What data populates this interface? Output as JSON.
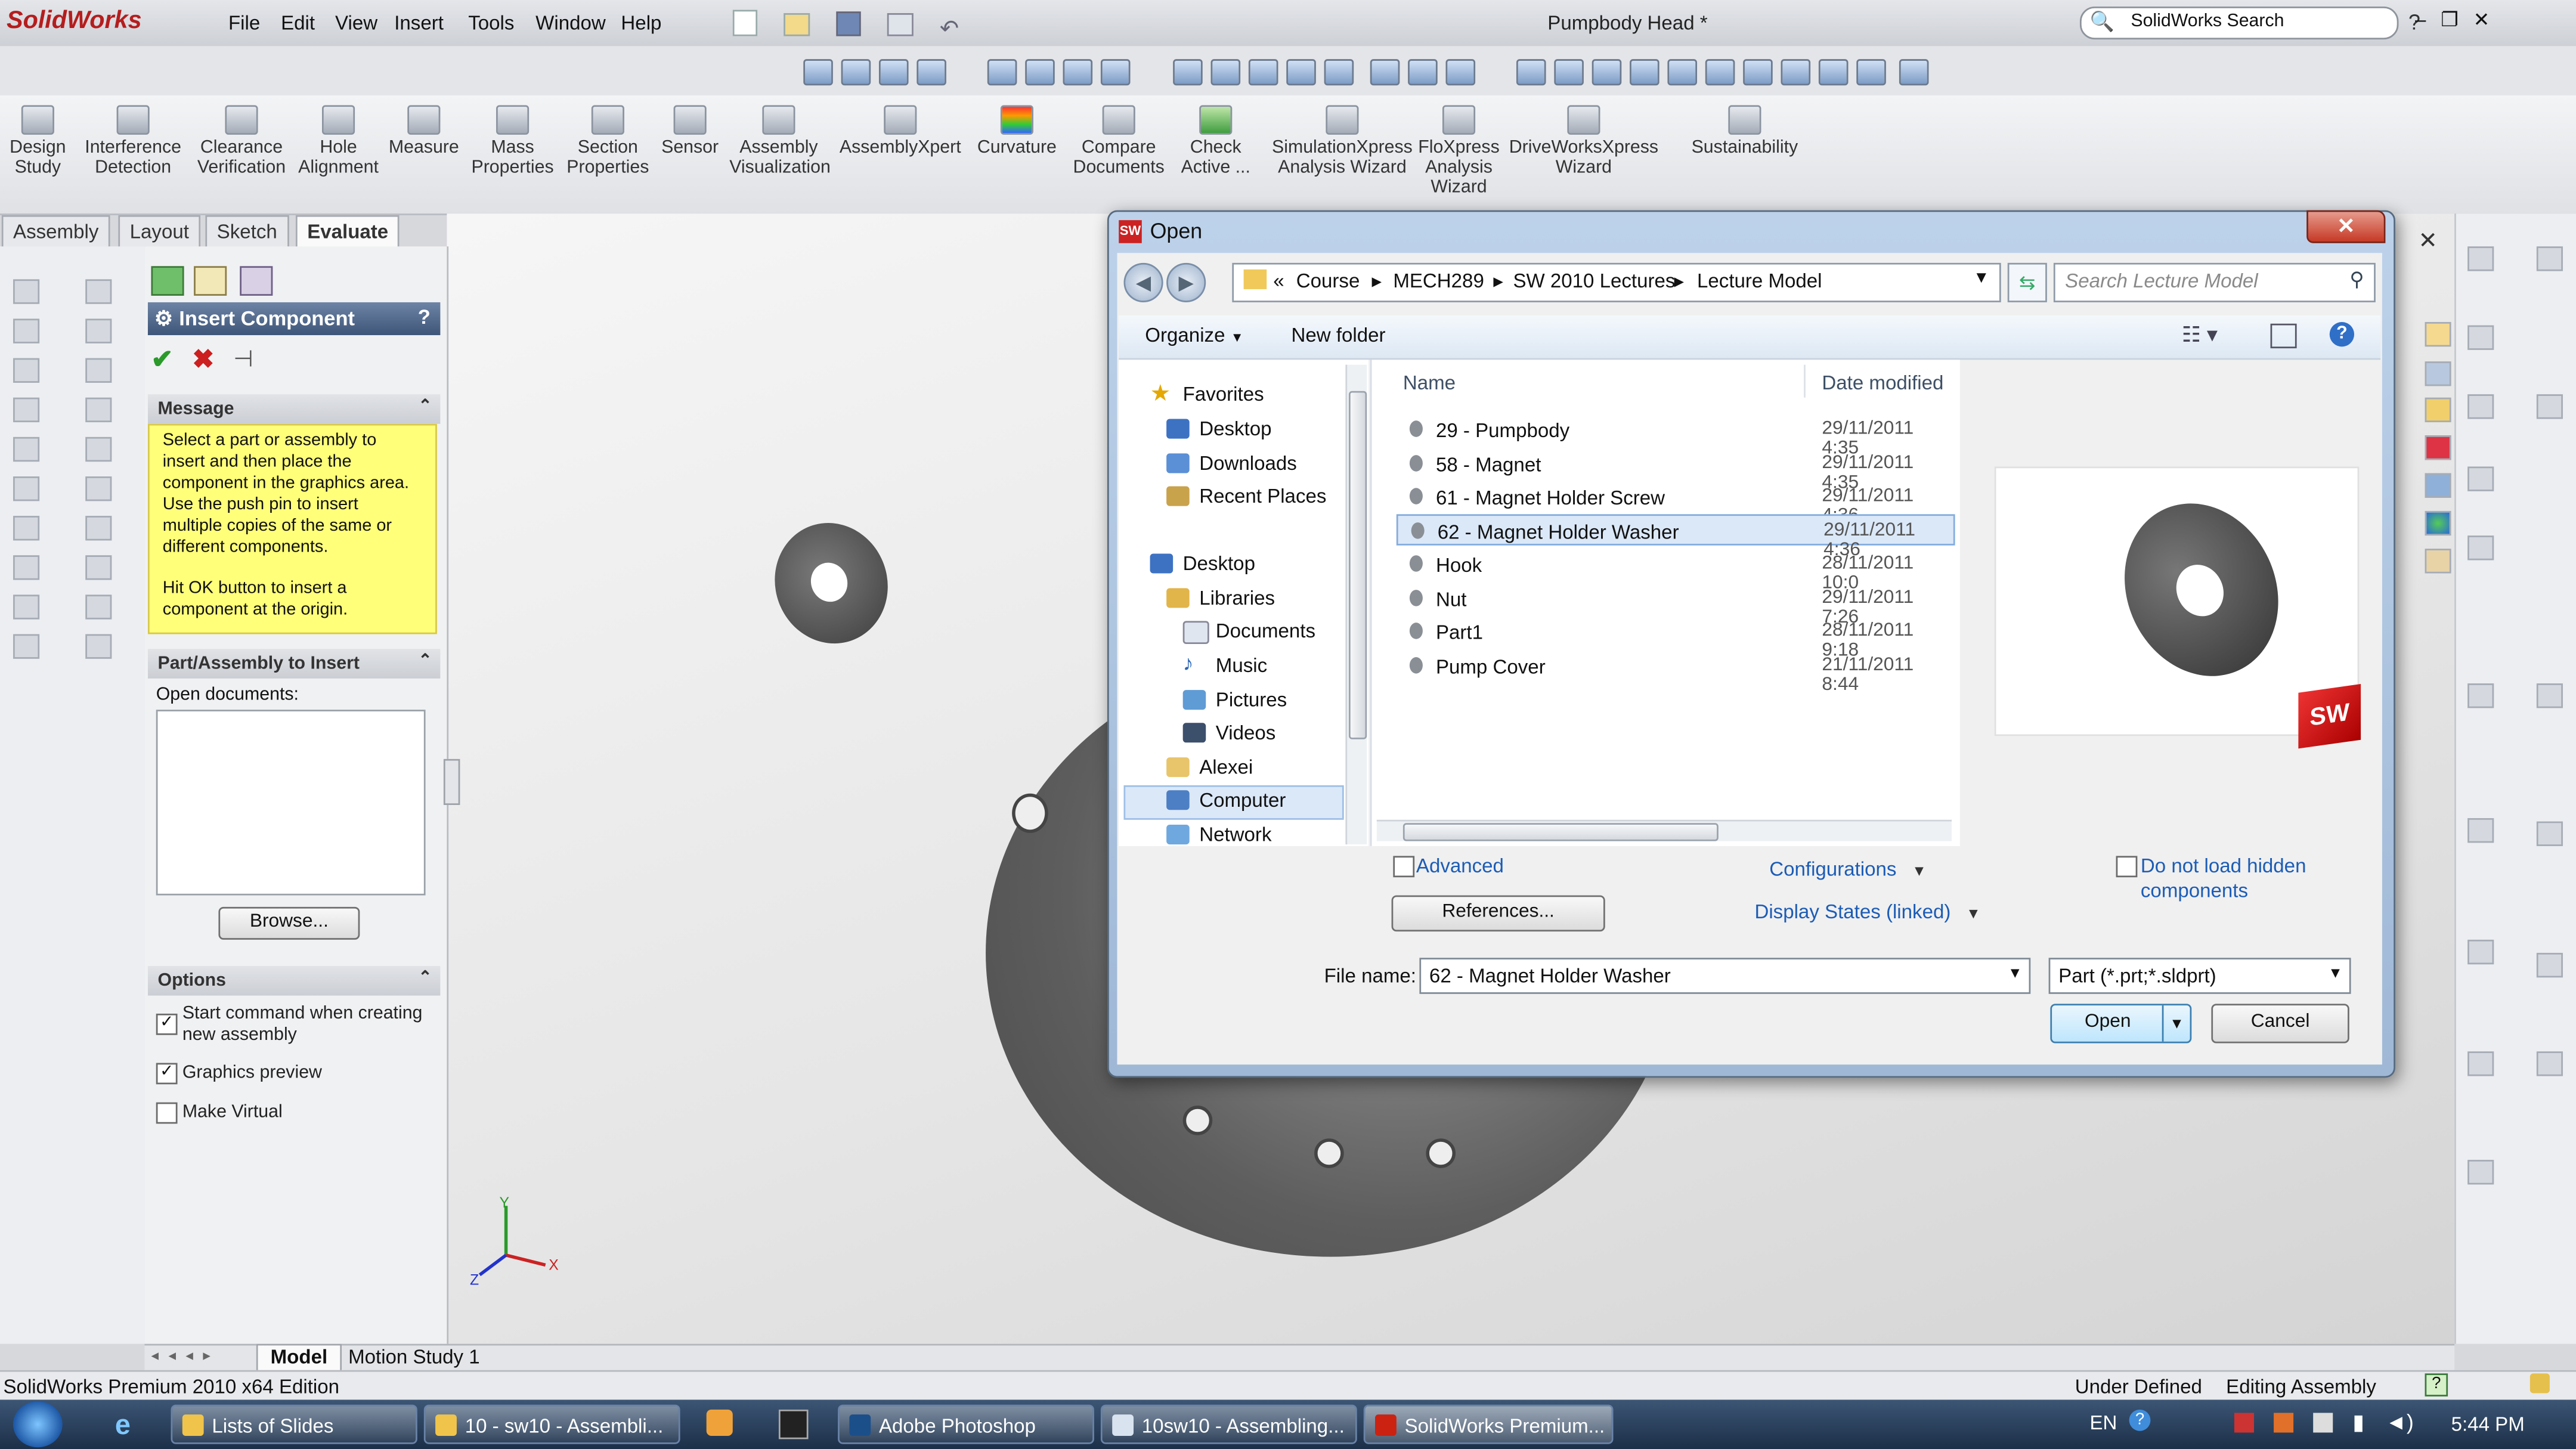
{
  "app": {
    "logo": "SolidWorks",
    "document_title": "Pumpbody Head *",
    "search_placeholder": "SolidWorks Search"
  },
  "menu": [
    "File",
    "Edit",
    "View",
    "Insert",
    "Tools",
    "Window",
    "Help"
  ],
  "commands": [
    {
      "label": "Design Study"
    },
    {
      "label": "Interference Detection"
    },
    {
      "label": "Clearance Verification"
    },
    {
      "label": "Hole Alignment"
    },
    {
      "label": "Measure"
    },
    {
      "label": "Mass Properties"
    },
    {
      "label": "Section Properties"
    },
    {
      "label": "Sensor"
    },
    {
      "label": "Assembly Visualization"
    },
    {
      "label": "AssemblyXpert"
    },
    {
      "label": "Curvature"
    },
    {
      "label": "Compare Documents"
    },
    {
      "label": "Check Active ..."
    },
    {
      "label": "SimulationXpress Analysis Wizard"
    },
    {
      "label": "FloXpress Analysis Wizard"
    },
    {
      "label": "DriveWorksXpress Wizard"
    },
    {
      "label": "Sustainability"
    }
  ],
  "tabs": [
    "Assembly",
    "Layout",
    "Sketch",
    "Evaluate"
  ],
  "property_manager": {
    "title": "Insert Component",
    "message_header": "Message",
    "message_text": "Select a part or assembly to insert and then place the component in the graphics area. Use the push pin to insert multiple copies of the same or different components.",
    "message_text2": "Hit OK button to insert a component at the origin.",
    "part_header": "Part/Assembly to Insert",
    "open_documents_label": "Open documents:",
    "browse_label": "Browse...",
    "options_header": "Options",
    "options": [
      {
        "label": "Start command when creating new assembly",
        "checked": true
      },
      {
        "label": "Graphics preview",
        "checked": true
      },
      {
        "label": "Make Virtual",
        "checked": false
      }
    ]
  },
  "dialog": {
    "title": "Open",
    "breadcrumb": [
      "Course",
      "MECH289",
      "SW 2010 Lectures",
      "Lecture Model"
    ],
    "search_placeholder": "Search Lecture Model",
    "organize": "Organize",
    "new_folder": "New folder",
    "nav": [
      {
        "label": "Favorites",
        "icon": "star-icon"
      },
      {
        "label": "Desktop",
        "icon": "desktop-icon"
      },
      {
        "label": "Downloads",
        "icon": "downloads-icon"
      },
      {
        "label": "Recent Places",
        "icon": "recent-places-icon"
      },
      {
        "label": "Desktop",
        "icon": "desktop-icon"
      },
      {
        "label": "Libraries",
        "icon": "libraries-icon"
      },
      {
        "label": "Documents",
        "icon": "documents-icon"
      },
      {
        "label": "Music",
        "icon": "music-icon"
      },
      {
        "label": "Pictures",
        "icon": "pictures-icon"
      },
      {
        "label": "Videos",
        "icon": "videos-icon"
      },
      {
        "label": "Alexei",
        "icon": "user-folder-icon"
      },
      {
        "label": "Computer",
        "icon": "computer-icon"
      },
      {
        "label": "Network",
        "icon": "network-icon"
      }
    ],
    "columns": [
      "Name",
      "Date modified"
    ],
    "files": [
      {
        "name": "29 - Pumpbody",
        "date": "29/11/2011 4:35"
      },
      {
        "name": "58 - Magnet",
        "date": "29/11/2011 4:35"
      },
      {
        "name": "61 - Magnet Holder Screw",
        "date": "29/11/2011 4:36"
      },
      {
        "name": "62 - Magnet Holder Washer",
        "date": "29/11/2011 4:36"
      },
      {
        "name": "Hook",
        "date": "28/11/2011 10:0"
      },
      {
        "name": "Nut",
        "date": "29/11/2011 7:26"
      },
      {
        "name": "Part1",
        "date": "28/11/2011 9:18"
      },
      {
        "name": "Pump Cover",
        "date": "21/11/2011 8:44"
      }
    ],
    "selected_file": "62 - Magnet Holder Washer",
    "advanced": "Advanced",
    "configurations": "Configurations",
    "references": "References...",
    "display_states": "Display States (linked)",
    "do_not_load": "Do not load hidden components",
    "file_name_label": "File name:",
    "file_name_value": "62 - Magnet Holder Washer",
    "file_type": "Part (*.prt;*.sldprt)",
    "open_btn": "Open",
    "cancel_btn": "Cancel",
    "sw_badge": "SW"
  },
  "bottom_tabs": [
    "Model",
    "Motion Study 1"
  ],
  "status": {
    "left": "SolidWorks Premium 2010 x64 Edition",
    "under_defined": "Under Defined",
    "editing": "Editing Assembly"
  },
  "taskbar": [
    {
      "label": "Lists of Slides"
    },
    {
      "label": "10 - sw10 - Assembli..."
    },
    {
      "label": "Adobe Photoshop"
    },
    {
      "label": "10sw10 - Assembling..."
    },
    {
      "label": "SolidWorks Premium..."
    }
  ],
  "tray": {
    "lang": "EN",
    "time": "5:44 PM"
  },
  "triad": {
    "x": "X",
    "y": "Y",
    "z": "Z"
  }
}
